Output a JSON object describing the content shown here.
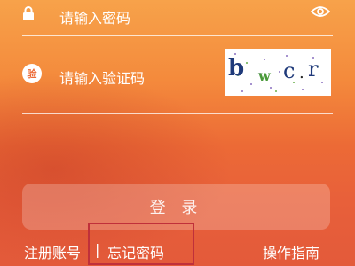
{
  "password_field": {
    "placeholder": "请输入密码",
    "icon": "lock-icon",
    "toggle_icon": "eye-icon"
  },
  "captcha_field": {
    "placeholder": "请输入验证码",
    "icon_label": "验",
    "captcha_text": "bwcr"
  },
  "login_button": {
    "label": "登 录"
  },
  "footer": {
    "register": "注册账号",
    "separator": "|",
    "forgot_password": "忘记密码",
    "guide": "操作指南"
  },
  "colors": {
    "background_top": "#f7a24a",
    "background_bottom": "#e35a3a",
    "highlight_border": "#c0303a"
  }
}
